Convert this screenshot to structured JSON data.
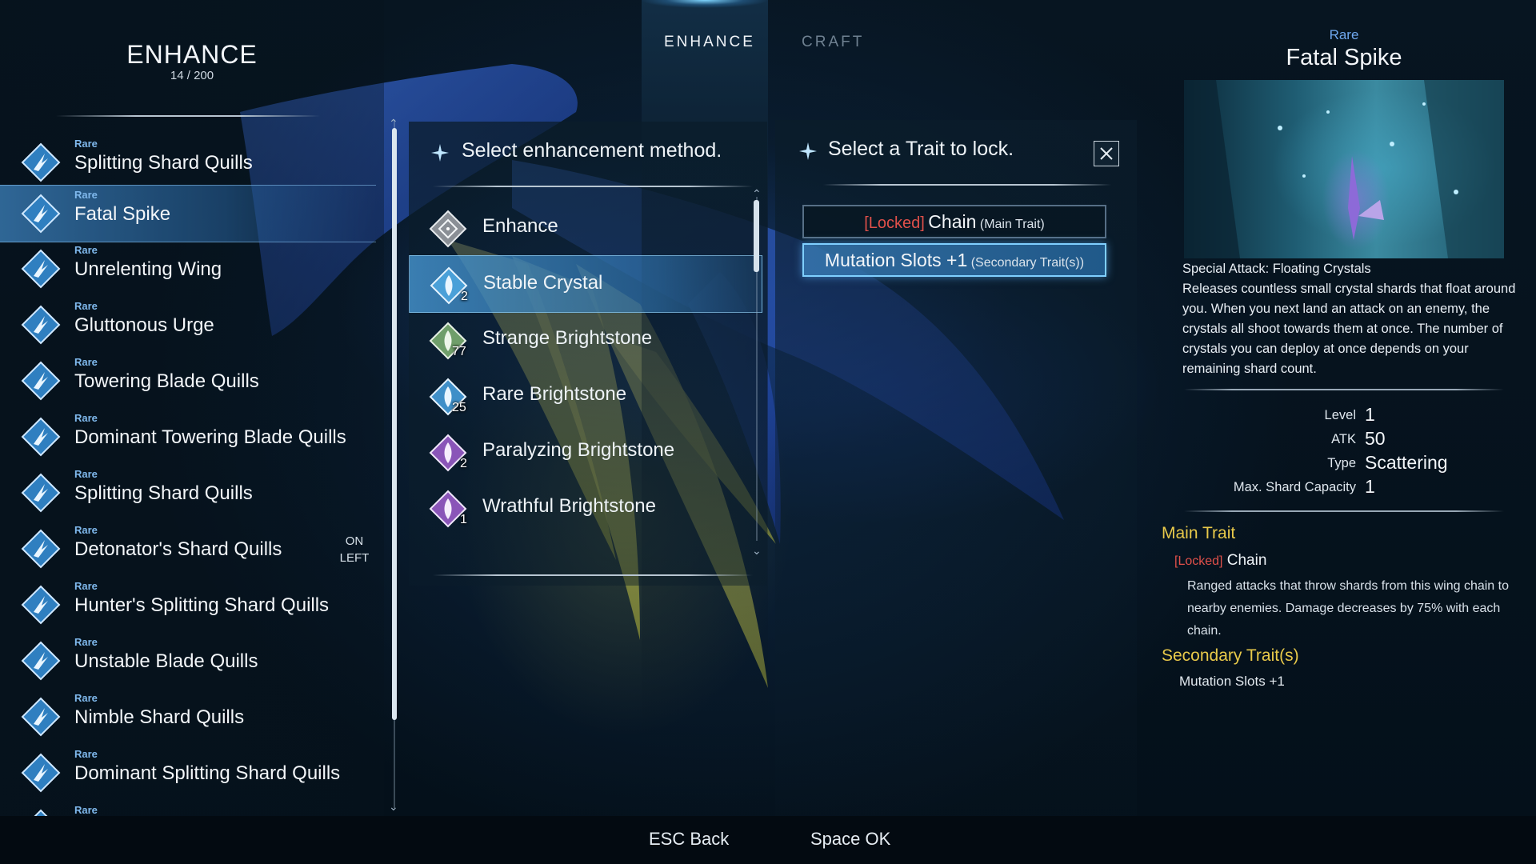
{
  "tabs": {
    "enhance": "ENHANCE",
    "craft": "CRAFT"
  },
  "left": {
    "title": "ENHANCE",
    "count": "14 / 200",
    "on_left": "ON\nLEFT",
    "items": [
      {
        "rarity": "Rare",
        "name": "Splitting Shard Quills"
      },
      {
        "rarity": "Rare",
        "name": "Fatal Spike"
      },
      {
        "rarity": "Rare",
        "name": "Unrelenting Wing"
      },
      {
        "rarity": "Rare",
        "name": "Gluttonous Urge"
      },
      {
        "rarity": "Rare",
        "name": "Towering Blade Quills"
      },
      {
        "rarity": "Rare",
        "name": "Dominant Towering Blade Quills"
      },
      {
        "rarity": "Rare",
        "name": "Splitting Shard Quills"
      },
      {
        "rarity": "Rare",
        "name": "Detonator's Shard Quills"
      },
      {
        "rarity": "Rare",
        "name": "Hunter's Splitting Shard Quills"
      },
      {
        "rarity": "Rare",
        "name": "Unstable Blade Quills"
      },
      {
        "rarity": "Rare",
        "name": "Nimble Shard Quills"
      },
      {
        "rarity": "Rare",
        "name": "Dominant Splitting Shard Quills"
      },
      {
        "rarity": "Rare",
        "name": ""
      }
    ]
  },
  "methods": {
    "heading": "Select enhancement method.",
    "items": [
      {
        "name": "Enhance",
        "count": ""
      },
      {
        "name": "Stable Crystal",
        "count": "2"
      },
      {
        "name": "Strange Brightstone",
        "count": "77"
      },
      {
        "name": "Rare Brightstone",
        "count": "25"
      },
      {
        "name": "Paralyzing Brightstone",
        "count": "2"
      },
      {
        "name": "Wrathful Brightstone",
        "count": "1"
      }
    ]
  },
  "traits": {
    "heading": "Select a Trait to lock.",
    "rows": [
      {
        "locked": "[Locked]",
        "name": "Chain",
        "type": "(Main Trait)"
      },
      {
        "locked": "",
        "name": "Mutation Slots +1",
        "type": "(Secondary Trait(s))"
      }
    ]
  },
  "detail": {
    "rarity": "Rare",
    "title": "Fatal Spike",
    "special_title": "Special Attack: Floating Crystals",
    "special_desc": "Releases countless small crystal shards that float around you. When you next land an attack on an enemy, the crystals all shoot towards them at once. The number of crystals you can deploy at once depends on your remaining shard count.",
    "stats": [
      {
        "label": "Level",
        "value": "1"
      },
      {
        "label": "ATK",
        "value": "50"
      },
      {
        "label": "Type",
        "value": "Scattering"
      },
      {
        "label": "Max. Shard Capacity",
        "value": "1"
      }
    ],
    "main_trait_head": "Main Trait",
    "main_trait_locked": "[Locked]",
    "main_trait_name": "Chain",
    "main_trait_desc": "Ranged attacks that throw shards from this wing chain to nearby enemies. Damage decreases by 75% with each chain.",
    "secondary_head": "Secondary Trait(s)",
    "secondary_trait": "Mutation Slots +1"
  },
  "bottom": {
    "back": "ESC Back",
    "ok": "Space OK"
  },
  "colors": {
    "accent": "#7fcfff",
    "rare": "#7fb8ec",
    "locked": "#e0504a",
    "section": "#e8c94a"
  },
  "icons": {
    "item": "diamond-wing-icon",
    "method": "diamond-crystal-icon",
    "panel": "four-point-star-icon",
    "close": "close-icon",
    "scroll_up": "chevron-up-icon",
    "scroll_down": "chevron-down-icon"
  }
}
